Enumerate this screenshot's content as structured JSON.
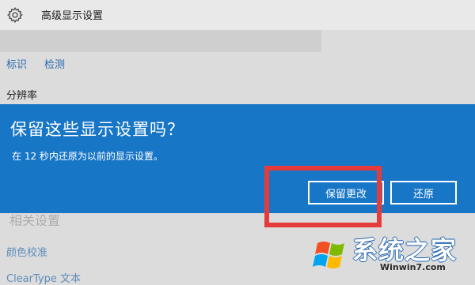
{
  "window": {
    "title": "高级显示设置"
  },
  "tabs": [
    {
      "label": "标识"
    },
    {
      "label": "检测"
    }
  ],
  "resolution": {
    "label": "分辨率"
  },
  "related": {
    "heading": "相关设置"
  },
  "links": [
    {
      "label": "颜色校准"
    },
    {
      "label": "ClearType 文本"
    }
  ],
  "dialog": {
    "title": "保留这些显示设置吗？",
    "message": "在 12 秒内还原为以前的显示设置。",
    "keep_label": "保留更改",
    "revert_label": "还原"
  },
  "watermark": {
    "text": "系统之家",
    "url": "Winwin7.com"
  },
  "colors": {
    "dialog_bg": "#1876c7",
    "highlight": "#e63b3b",
    "page_bg": "#dcdcdc"
  }
}
